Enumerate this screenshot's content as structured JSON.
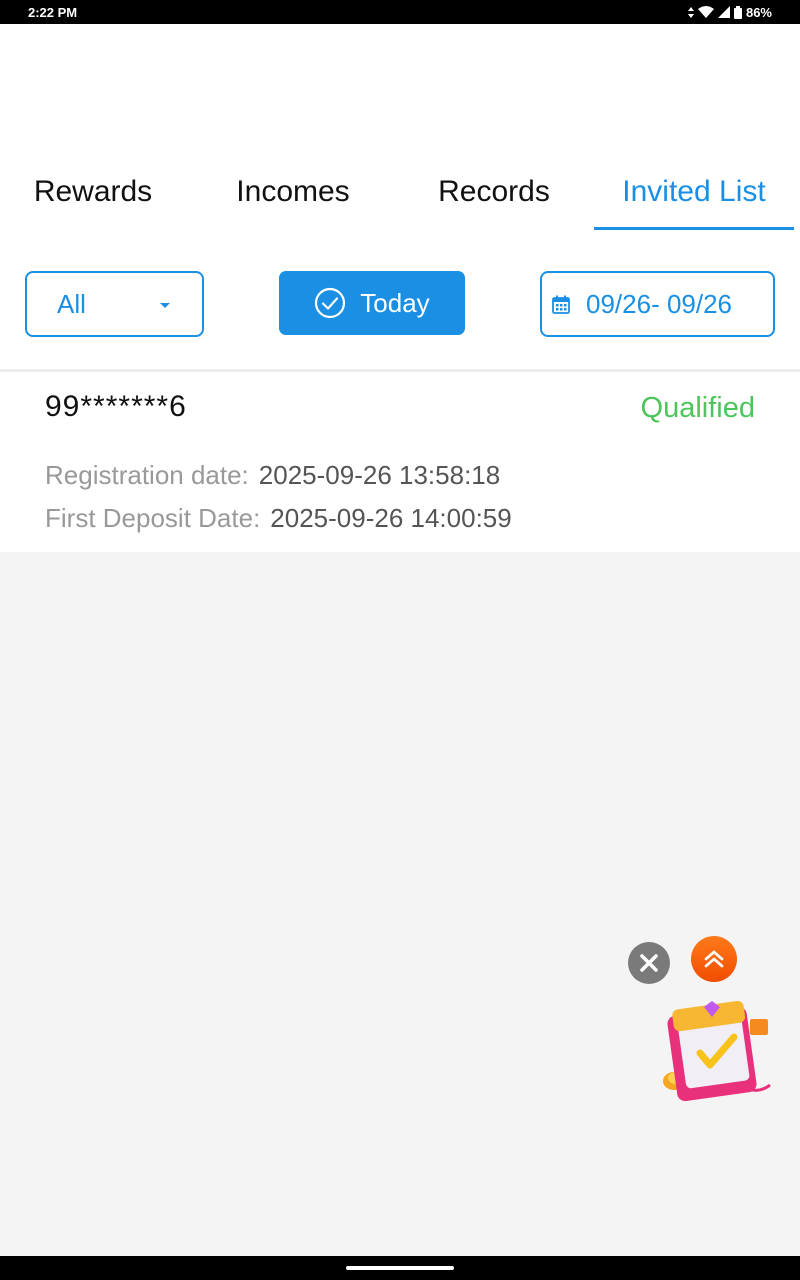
{
  "status_bar": {
    "time": "2:22 PM",
    "battery": "86%"
  },
  "tabs": [
    {
      "label": "Rewards",
      "active": false
    },
    {
      "label": "Incomes",
      "active": false
    },
    {
      "label": "Records",
      "active": false
    },
    {
      "label": "Invited List",
      "active": true
    }
  ],
  "filters": {
    "type_select": "All",
    "today_label": "Today",
    "date_range": "09/26- 09/26"
  },
  "records": [
    {
      "phone": "99*******6",
      "status": "Qualified",
      "registration_label": "Registration date:",
      "registration_value": "2025-09-26 13:58:18",
      "deposit_label": "First Deposit Date:",
      "deposit_value": "2025-09-26 14:00:59"
    }
  ],
  "colors": {
    "accent": "#1a8fe3",
    "qualified": "#4cc65a",
    "background": "#f4f4f4"
  },
  "icons": [
    "wifi-icon",
    "signal-icon",
    "battery-icon",
    "caret-down-icon",
    "check-circle-icon",
    "calendar-icon",
    "close-icon",
    "double-chevron-up-icon",
    "gift-checkin-icon"
  ]
}
